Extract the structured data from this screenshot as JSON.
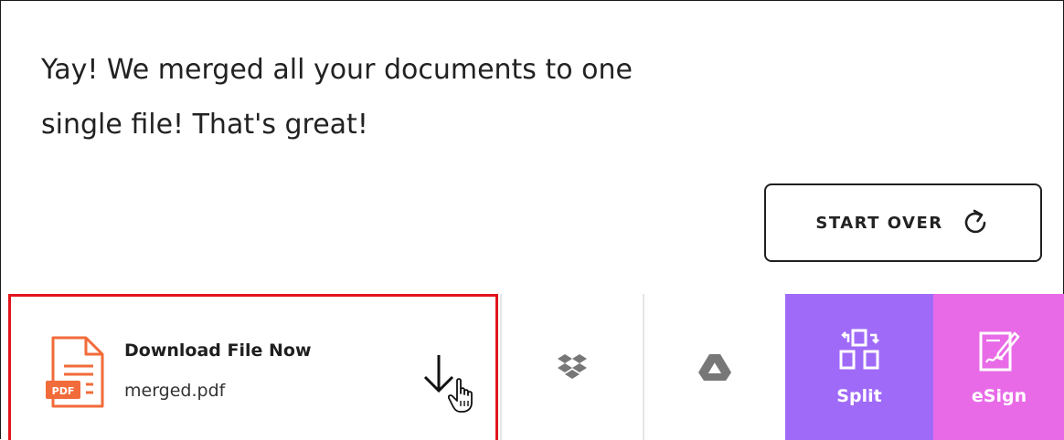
{
  "message": {
    "line1": "Yay! We merged all your documents to one",
    "line2": "single file! That's great!"
  },
  "start_over": {
    "label": "START OVER",
    "icon": "refresh-icon"
  },
  "download": {
    "title": "Download File Now",
    "filename": "merged.pdf",
    "file_badge": "PDF",
    "icons": [
      "pdf-file-icon",
      "download-arrow-icon",
      "hand-cursor-icon"
    ]
  },
  "tools": [
    {
      "name": "dropbox",
      "icon": "dropbox-icon",
      "label": ""
    },
    {
      "name": "google-drive",
      "icon": "google-drive-icon",
      "label": ""
    },
    {
      "name": "split",
      "icon": "split-icon",
      "label": "Split",
      "color": "#a06af8"
    },
    {
      "name": "esign",
      "icon": "esign-icon",
      "label": "eSign",
      "color": "#e86ae7"
    }
  ],
  "colors": {
    "highlight_border": "#e2141b",
    "pdf_accent": "#f26b3a",
    "split_bg": "#a06af8",
    "esign_bg": "#e86ae7"
  }
}
